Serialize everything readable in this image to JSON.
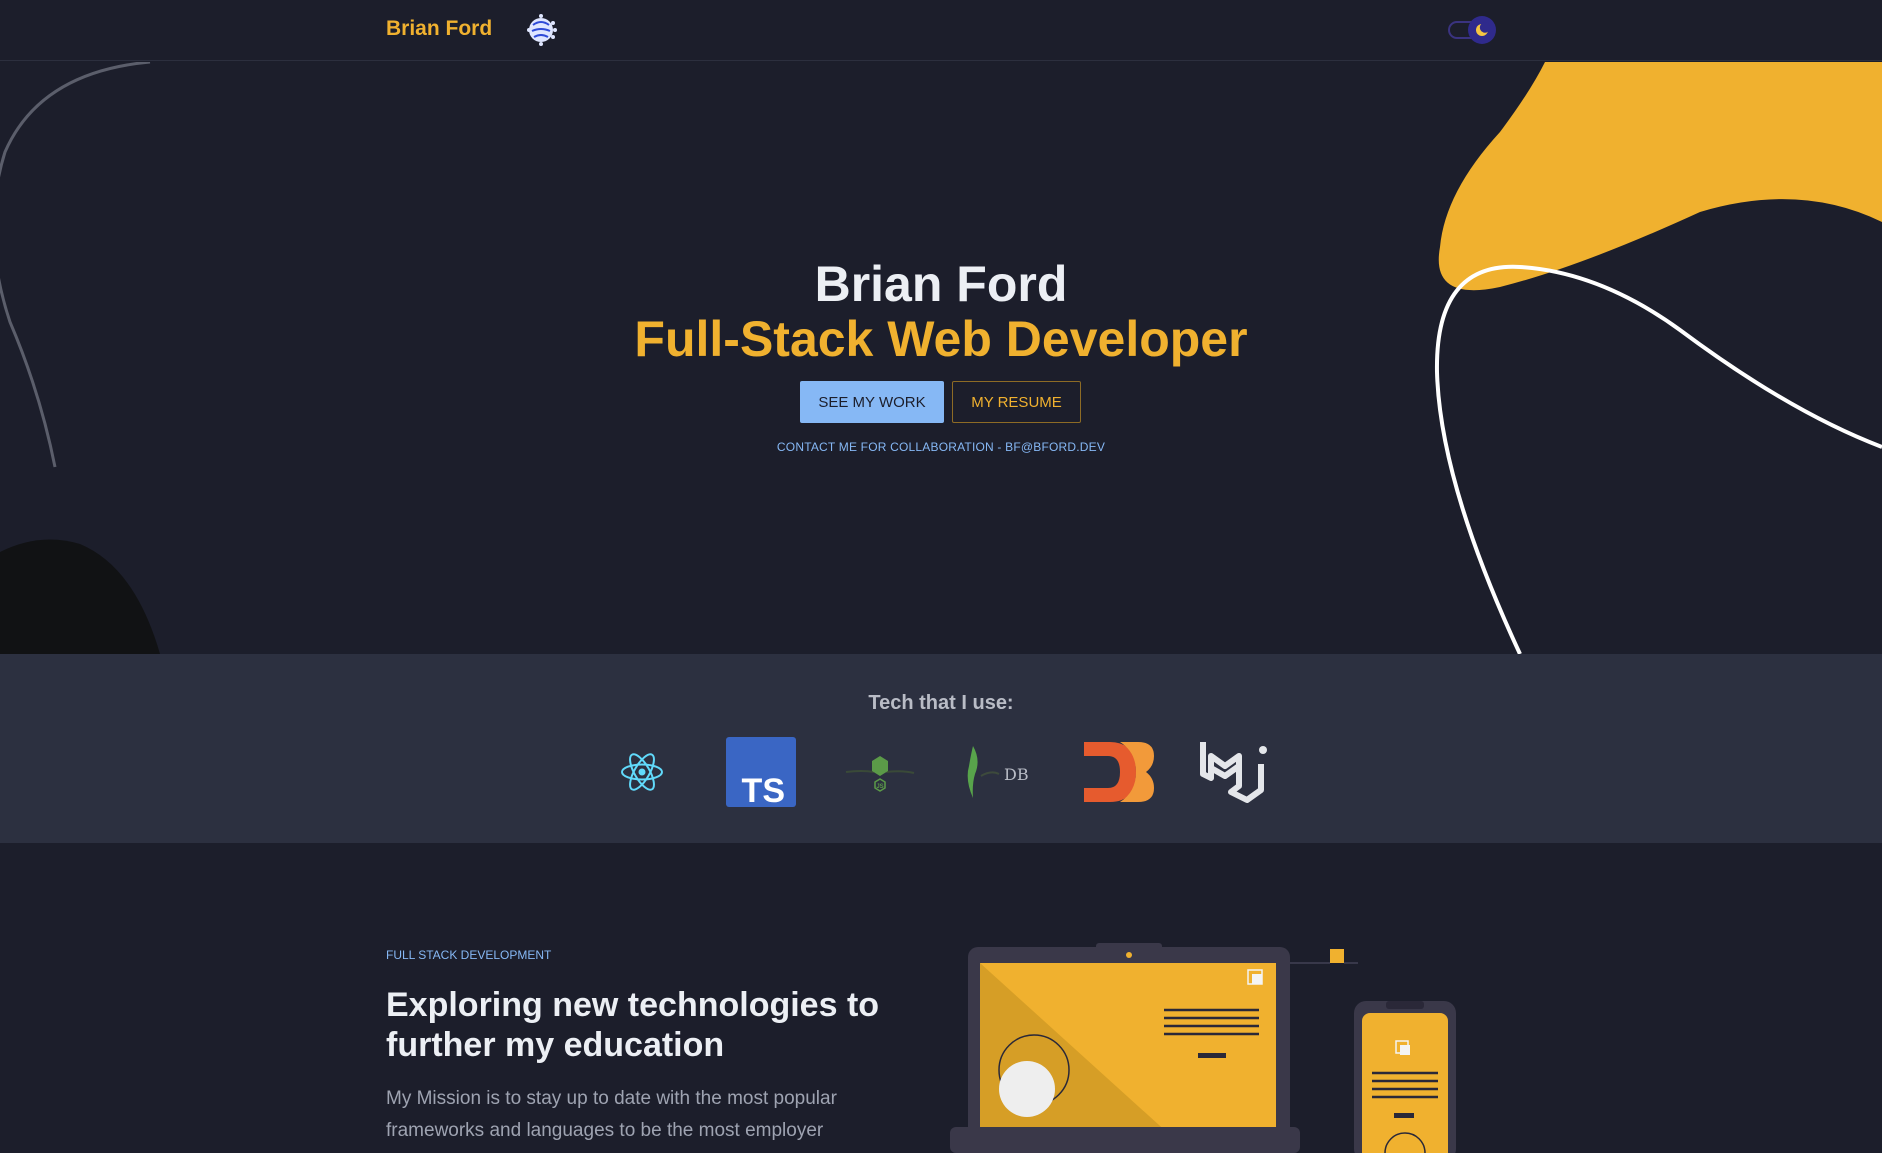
{
  "nav": {
    "brand": "Brian Ford",
    "brand_icon": "brain-circuit-icon",
    "theme_toggle_icon": "moon-icon"
  },
  "hero": {
    "name": "Brian Ford",
    "role": "Full-Stack Web Developer",
    "primary_button": "SEE MY WORK",
    "secondary_button": "MY RESUME",
    "contact": "CONTACT ME FOR COLLABORATION - BF@BFORD.DEV"
  },
  "tech": {
    "title": "Tech that I use:",
    "logos": [
      {
        "icon": "react-icon"
      },
      {
        "icon": "typescript-icon",
        "text": "TS"
      },
      {
        "icon": "nodejs-icon",
        "text": "JS"
      },
      {
        "icon": "mongodb-icon",
        "text": "DB"
      },
      {
        "icon": "d3-icon"
      },
      {
        "icon": "material-ui-icon"
      }
    ]
  },
  "mission": {
    "eyebrow": "FULL STACK DEVELOPMENT",
    "title": "Exploring new technologies to further my education",
    "text": "My Mission is to stay up to date with the most popular frameworks and languages to be the most employer",
    "illustration_icon": "responsive-devices-icon"
  },
  "colors": {
    "background": "#1c1e2b",
    "accent": "#f0b12f",
    "link": "#86b8f5",
    "band": "#2c3040"
  }
}
